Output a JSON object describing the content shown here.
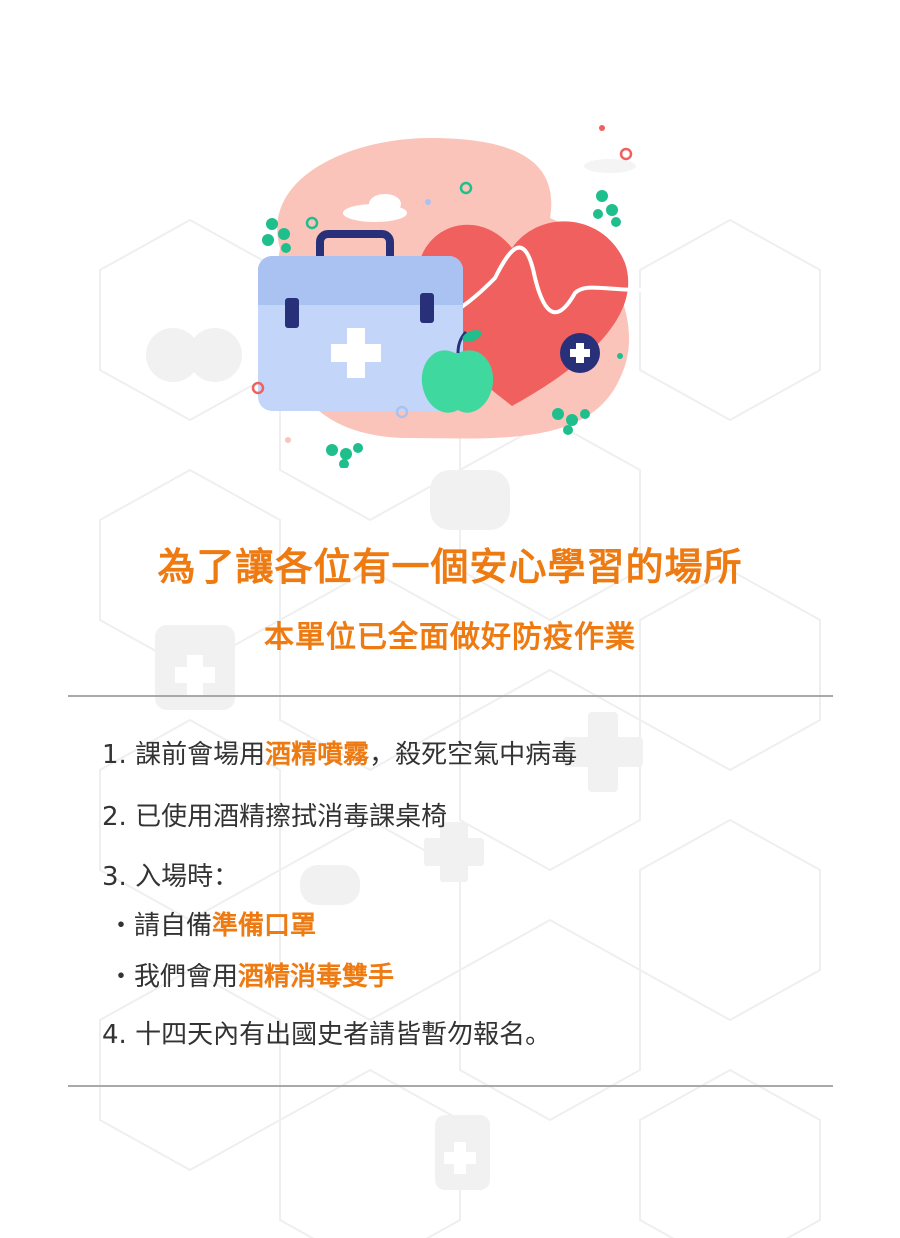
{
  "colors": {
    "accent": "#ee7a12",
    "text": "#333333",
    "rule": "#a9a9a9",
    "blob": "#fbc4bb",
    "heart": "#f0605e",
    "kit": "#a9c2f2",
    "apple": "#3fd9a0",
    "leaf": "#1fbe8d",
    "navy": "#29307a"
  },
  "icons": {
    "hero": "medical-kit-heart-illustration",
    "background": "medical-icons-hexagon-pattern"
  },
  "heading": {
    "title": "為了讓各位有一個安心學習的場所",
    "subtitle": "本單位已全面做好防疫作業"
  },
  "items": [
    {
      "pre": "1. 課前會場用",
      "hl": "酒精噴霧",
      "post": "，殺死空氣中病毒"
    },
    {
      "text": "2. 已使用酒精擦拭消毒課桌椅"
    },
    {
      "text": "3. 入場時："
    },
    {
      "pre": "・請自備",
      "hl": "準備口罩"
    },
    {
      "pre": "・我們會用",
      "hl": "酒精消毒雙手"
    },
    {
      "text": "4. 十四天內有出國史者請皆暫勿報名。"
    }
  ]
}
